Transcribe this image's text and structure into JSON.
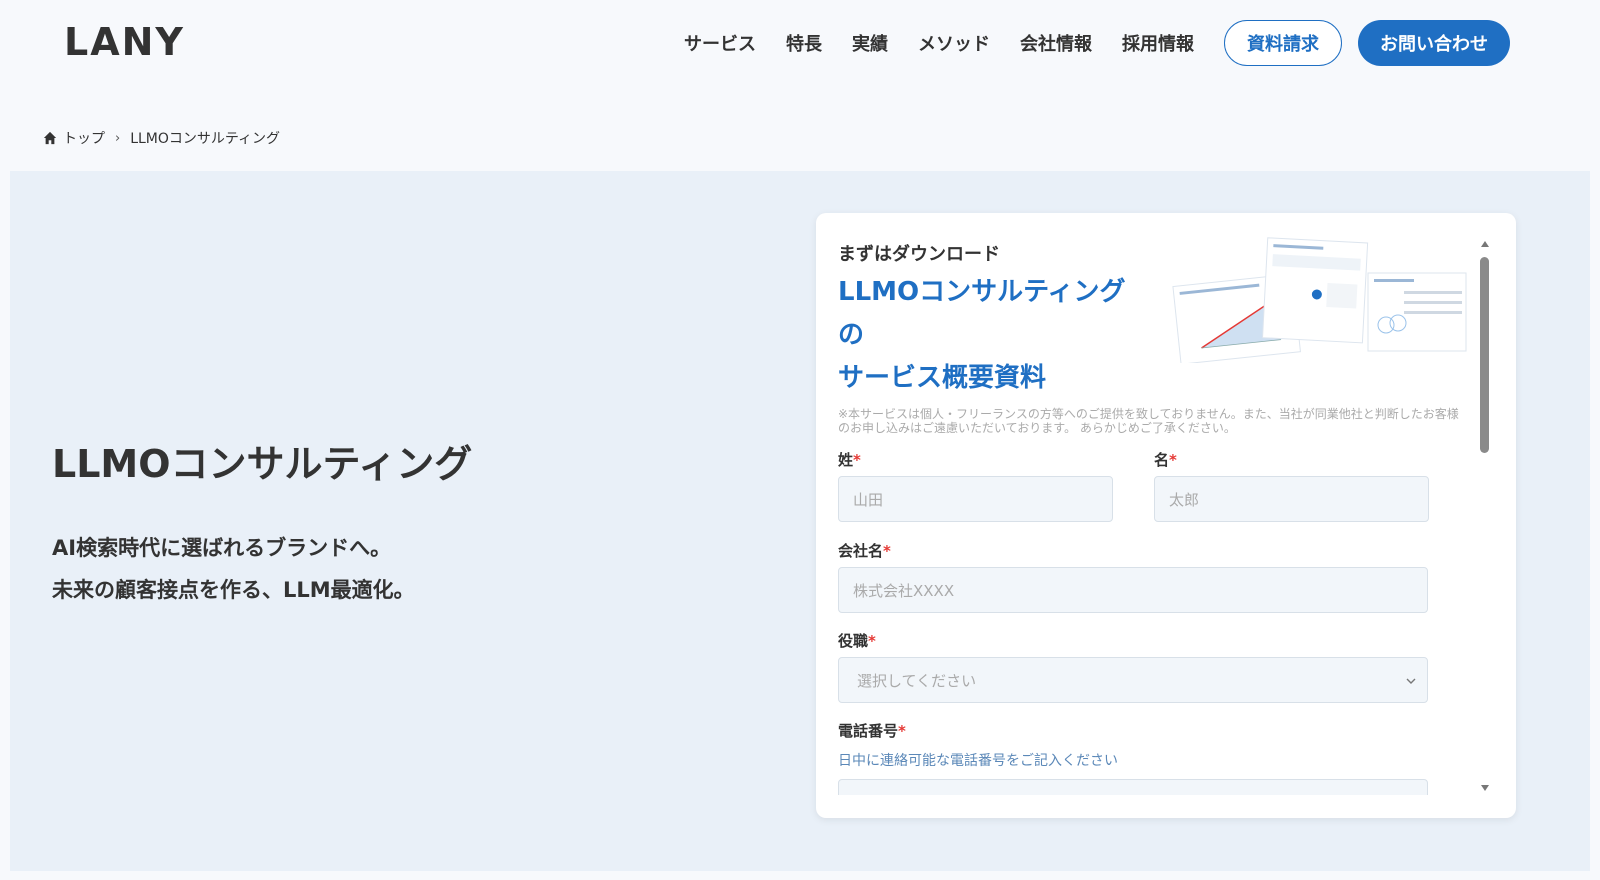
{
  "header": {
    "logo": "LANY",
    "nav": [
      "サービス",
      "特長",
      "実績",
      "メソッド",
      "会社情報",
      "採用情報"
    ],
    "btn_request": "資料請求",
    "btn_contact": "お問い合わせ"
  },
  "breadcrumb": {
    "home": "トップ",
    "current": "LLMOコンサルティング"
  },
  "hero": {
    "title": "LLMOコンサルティング",
    "sub1": "AI検索時代に選ばれるブランドへ。",
    "sub2": "未来の顧客接点を作る、LLM最適化。"
  },
  "form": {
    "dl_label": "まずはダウンロード",
    "title1": "LLMOコンサルティング",
    "title2": "の",
    "title3": "サービス概要資料",
    "disclaimer": "※本サービスは個人・フリーランスの方等へのご提供を致しておりません。また、当社が同業他社と判断したお客様のお申し込みはご遠慮いただいております。 あらかじめご了承ください。",
    "last_name_label": "姓",
    "last_name_placeholder": "山田",
    "first_name_label": "名",
    "first_name_placeholder": "太郎",
    "company_label": "会社名",
    "company_placeholder": "株式会社XXXX",
    "role_label": "役職",
    "role_placeholder": "選択してください",
    "phone_label": "電話番号",
    "phone_hint": "日中に連絡可能な電話番号をご記入ください",
    "required_mark": "*"
  },
  "colors": {
    "accent": "#1f6fc3",
    "hero_bg": "#e9f0f8",
    "required": "#e53935"
  }
}
